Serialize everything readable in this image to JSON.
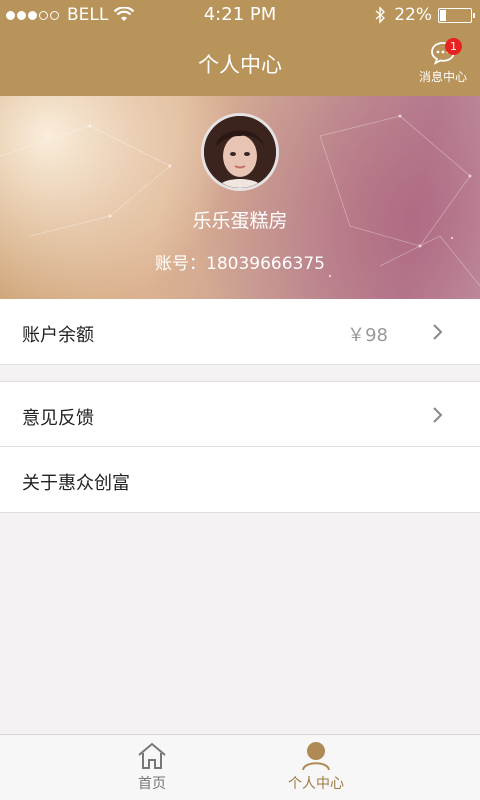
{
  "status_bar": {
    "carrier": "BELL",
    "time": "4:21 PM",
    "battery_text": "22%",
    "battery_level": 0.22
  },
  "header": {
    "title": "个人中心",
    "message_label": "消息中心",
    "message_badge": "1",
    "message_icon": "chat-bubble-icon"
  },
  "profile": {
    "username": "乐乐蛋糕房",
    "account": "账号：18039666375"
  },
  "list": {
    "balance": {
      "label": "账户余额",
      "value": "￥98"
    },
    "feedback": {
      "label": "意见反馈"
    },
    "about": {
      "label": "关于惠众创富"
    }
  },
  "tabs": [
    {
      "label": "首页",
      "icon": "home-icon",
      "active": false
    },
    {
      "label": "个人中心",
      "icon": "person-icon",
      "active": true
    }
  ],
  "colors": {
    "brand": "#b8935a",
    "badge": "#e8231f",
    "background": "#f4f2f2"
  }
}
